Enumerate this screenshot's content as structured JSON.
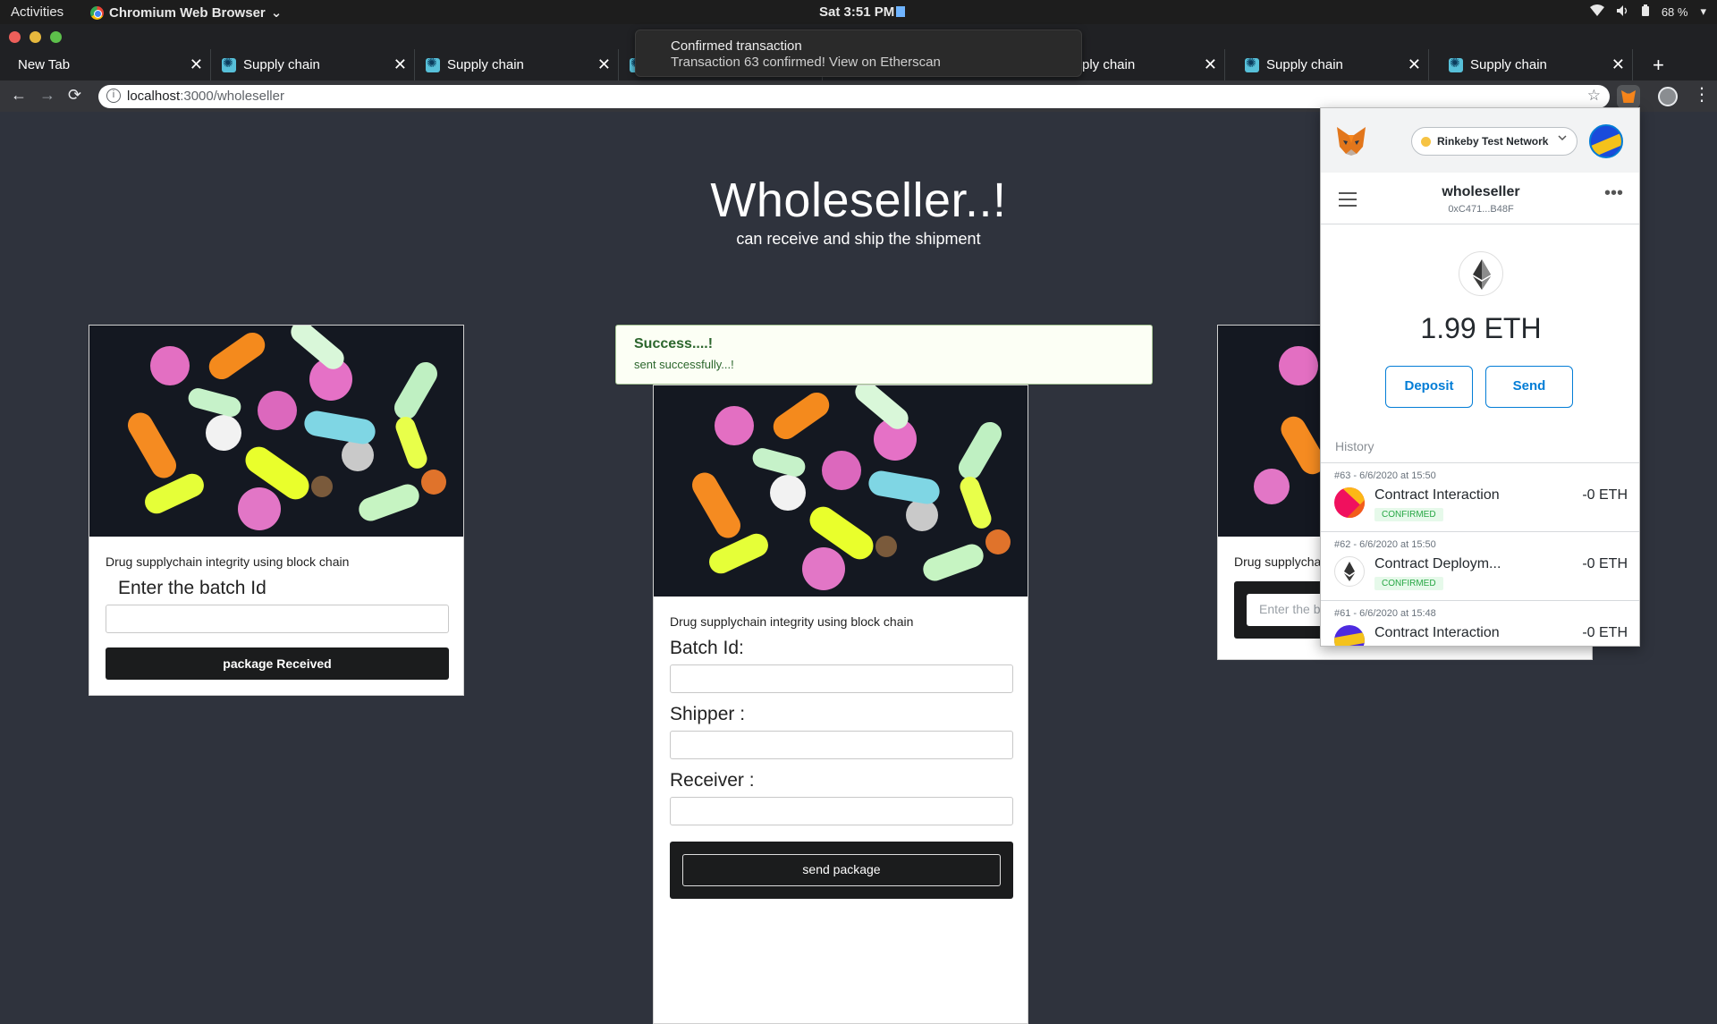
{
  "os_bar": {
    "activities": "Activities",
    "app_name": "Chromium Web Browser",
    "app_chevron": "⌄",
    "clock": "Sat  3:51 PM",
    "battery": "68 %",
    "wifi_icon": "wifi-icon",
    "volume_icon": "volume-icon"
  },
  "tabs": [
    {
      "label": "New Tab"
    },
    {
      "label": "Supply chain"
    },
    {
      "label": "Supply chain"
    },
    {
      "label": "ply chain"
    },
    {
      "label": "Supply chain"
    },
    {
      "label": "Supply chain"
    }
  ],
  "toolbar": {
    "url_host": "localhost",
    "url_path": ":3000/wholeseller"
  },
  "toast": {
    "title": "Confirmed transaction",
    "message": "Transaction 63 confirmed! View on Etherscan"
  },
  "page": {
    "heading": "Wholeseller..!",
    "subheading": "can receive and ship the shipment"
  },
  "card_receive": {
    "description": "Drug supplychain integrity using block chain",
    "label": "Enter the batch Id",
    "input_value": "",
    "button": "package Received"
  },
  "alert": {
    "header": "Success....!",
    "message": "sent successfully...!"
  },
  "card_ship": {
    "description": "Drug supplychain integrity using block chain",
    "batch_label": "Batch Id:",
    "shipper_label": "Shipper :",
    "receiver_label": "Receiver :",
    "button": "send package"
  },
  "card_third": {
    "description": "Drug supplychai",
    "placeholder": "Enter the b"
  },
  "metamask": {
    "network": "Rinkeby Test Network",
    "account_name": "wholeseller",
    "account_address": "0xC471...B48F",
    "balance": "1.99 ETH",
    "deposit": "Deposit",
    "send": "Send",
    "history_label": "History",
    "transactions": [
      {
        "date": "#63 - 6/6/2020 at 15:50",
        "title": "Contract Interaction",
        "status": "CONFIRMED",
        "amount": "-0 ETH"
      },
      {
        "date": "#62 - 6/6/2020 at 15:50",
        "title": "Contract Deploym...",
        "status": "CONFIRMED",
        "amount": "-0 ETH"
      },
      {
        "date": "#61 - 6/6/2020 at 15:48",
        "title": "Contract Interaction",
        "status": "",
        "amount": "-0 ETH"
      }
    ]
  },
  "colors": {
    "page_bg": "#2f333d",
    "metamask_blue": "#037dd6",
    "success_green": "#2c662d"
  }
}
